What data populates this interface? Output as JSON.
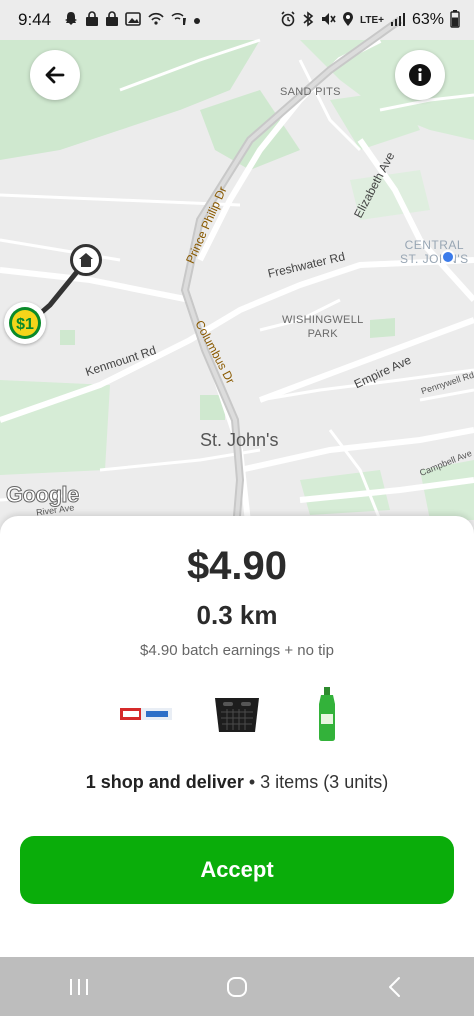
{
  "status_bar": {
    "time": "9:44",
    "battery": "63%",
    "network": "LTE+",
    "left_icons": [
      "snapchat-icon",
      "lock-icon",
      "lock-icon",
      "gallery-icon",
      "wifi-call-icon",
      "dot-icon"
    ],
    "right_icons": [
      "alarm-icon",
      "bluetooth-icon",
      "mute-icon",
      "location-icon",
      "signal-icon",
      "battery-icon"
    ]
  },
  "map": {
    "labels": {
      "sand_pits": "SAND PITS",
      "prince_philip": "Prince Philip Dr",
      "elizabeth": "Elizabeth Ave",
      "central": "CENTRAL",
      "central_line2": "ST. JOHN'S",
      "freshwater": "Freshwater Rd",
      "wishingwell": "WISHINGWELL",
      "park": "PARK",
      "columbus": "Columbus Dr",
      "kenmount": "Kenmount Rd",
      "empire": "Empire Ave",
      "pennywell": "Pennywell Rd",
      "st_johns": "St. John's",
      "campbell": "Campbell Ave",
      "river": "River Ave"
    },
    "google_logo": "Google",
    "store_marker": "Dollarama",
    "colors": {
      "background": "#ececec",
      "green_space": "#cfe8cf",
      "road": "#ffffff",
      "highway": "#c8c8c8",
      "route": "#333333",
      "location_dot": "#3b7bea"
    }
  },
  "buttons": {
    "back_icon": "arrow-left-icon",
    "info_icon": "info-icon"
  },
  "offer": {
    "earnings": "$4.90",
    "distance": "0.3 km",
    "breakdown": "$4.90 batch earnings + no tip",
    "items": [
      {
        "name": "colgate-toothpaste"
      },
      {
        "name": "black-storage-basket"
      },
      {
        "name": "green-dish-soap"
      }
    ],
    "summary_bold": "1 shop and deliver",
    "summary_separator": "•",
    "summary_rest": "3 items (3 units)",
    "accept_label": "Accept",
    "accent_color": "#0aad0a"
  },
  "nav_bar": {
    "icons": [
      "recent-apps-icon",
      "home-icon",
      "back-icon"
    ]
  }
}
